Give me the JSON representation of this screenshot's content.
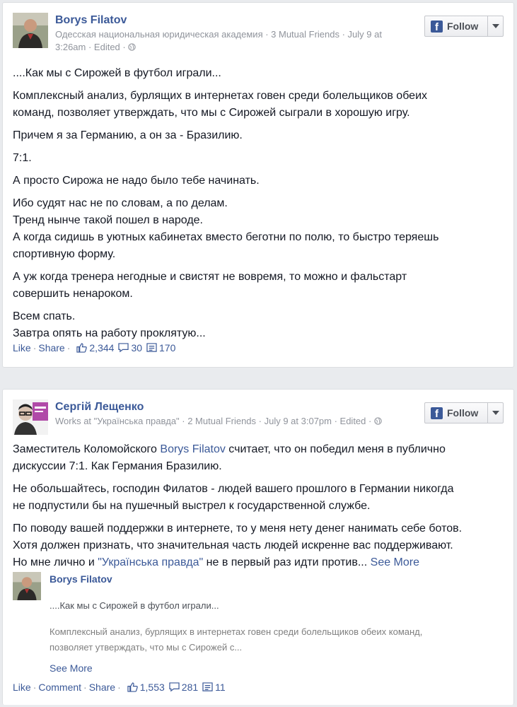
{
  "posts": [
    {
      "author": "Borys Filatov",
      "meta_line1": "Одесская национальная юридическая академия · 3 Mutual Friends · July 9 at",
      "meta_line2": "3:26am · Edited ·",
      "follow_label": "Follow",
      "paragraphs": [
        "....Как мы с Сирожей в футбол играли...",
        "Комплексный анализ, бурлящих в интернетах говен среди болельщиков обеих",
        "команд, позволяет утверждать, что мы с Сирожей сыграли в хорошую игру.",
        "Причем я за Германию, а он за - Бразилию.",
        "7:1.",
        "А просто Сирожа не надо было тебе начинать.",
        "Ибо судят нас не по словам, а по делам.",
        "Тренд нынче такой пошел в народе.",
        "А когда сидишь в уютных кабинетах вместо беготни по полю, то быстро теряешь",
        "спортивную форму.",
        "А уж когда тренера негодные и свистят не вовремя, то можно и фальстарт",
        "совершить ненароком.",
        "Всем спать.",
        "Завтра опять на работу проклятую..."
      ],
      "actions": {
        "like": "Like",
        "share": "Share"
      },
      "stats": {
        "likes": "2,344",
        "comments": "30",
        "shares": "170"
      }
    },
    {
      "author": "Сергій Лещенко",
      "meta_line1": "Works at \"Українська правда\" · 2 Mutual Friends · July 9 at 3:07pm · Edited ·",
      "follow_label": "Follow",
      "p1_a": "Заместитель Коломойского ",
      "p1_link": "Borys Filatov",
      "p1_b": " считает, что он победил меня в публично",
      "p1_c": "дискуссии 7:1. Как Германия Бразилию.",
      "p2_a": "Не обольшайтесь, господин Филатов - людей вашего прошлого в Германии никогда",
      "p2_b": "не подпустили бы на пушечный выстрел к государственной службе.",
      "p3_a": "По поводу вашей поддержки в интернете, то у меня нету денег нанимать себе ботов.",
      "p3_b": "Хотя должен признать, что значительная часть людей искренне вас поддерживают.",
      "p3_c": "Но мне лично и ",
      "p3_link": "\"Українська правда\"",
      "p3_d": " не в первый раз идти против... ",
      "see_more": "See More",
      "shared": {
        "author": "Borys Filatov",
        "text1": "....Как мы с Сирожей в футбол играли...",
        "text2_a": "Комплексный анализ, бурлящих в интернетах говен среди болельщиков обеих команд,",
        "text2_b": "позволяет утверждать, что мы с Сирожей с...",
        "see_more": "See More"
      },
      "actions": {
        "like": "Like",
        "comment": "Comment",
        "share": "Share"
      },
      "stats": {
        "likes": "1,553",
        "comments": "281",
        "shares": "11"
      }
    }
  ]
}
